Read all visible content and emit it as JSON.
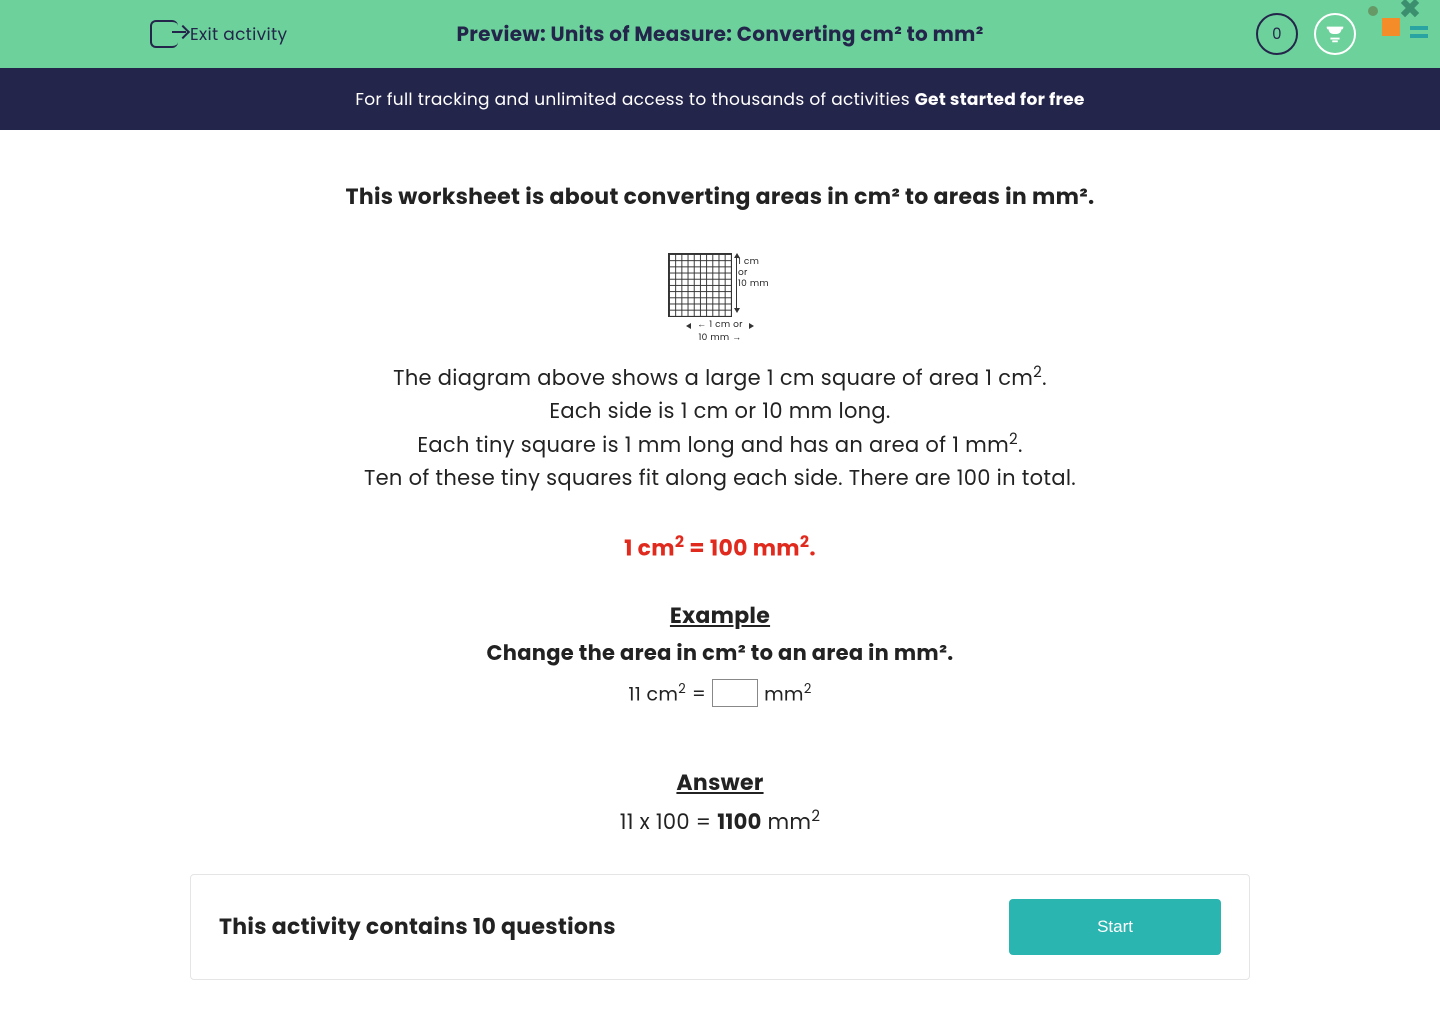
{
  "header": {
    "exit_label": "Exit activity",
    "title": "Preview: Units of Measure: Converting cm² to mm²",
    "counter": "0"
  },
  "banner": {
    "text": "For full tracking and unlimited access to thousands of activities ",
    "cta": "Get started for free"
  },
  "content": {
    "intro": "This worksheet is about converting areas in cm² to areas in mm².",
    "diagram_side_label_line1": "1 cm",
    "diagram_side_label_line2": "or",
    "diagram_side_label_line3": "10 mm",
    "diagram_bottom_label": "1 cm or 10 mm",
    "line1_a": "The diagram above shows a large 1 cm square of area 1 cm",
    "line1_sup": "2",
    "line1_b": ".",
    "line2": "Each side is 1 cm or 10 mm long.",
    "line3_a": "Each tiny square is 1 mm long and has an area of 1 mm",
    "line3_sup": "2",
    "line3_b": ".",
    "line4": "Ten of these tiny squares fit along each side.  There are 100 in total.",
    "formula_a": "1 cm",
    "formula_sup1": "2",
    "formula_b": " = 100 mm",
    "formula_sup2": "2",
    "formula_c": ".",
    "example_heading": "Example",
    "example_prompt": "Change the area in cm² to an area in mm².",
    "eq_left": "11 cm",
    "eq_sup1": "2",
    "eq_equals": " = ",
    "eq_right": " mm",
    "eq_sup2": "2",
    "answer_heading": "Answer",
    "answer_a": "11 x 100 = ",
    "answer_bold": "1100",
    "answer_b": " mm",
    "answer_sup": "2"
  },
  "footer": {
    "question_count_text": "This activity contains 10 questions",
    "start_label": "Start"
  }
}
